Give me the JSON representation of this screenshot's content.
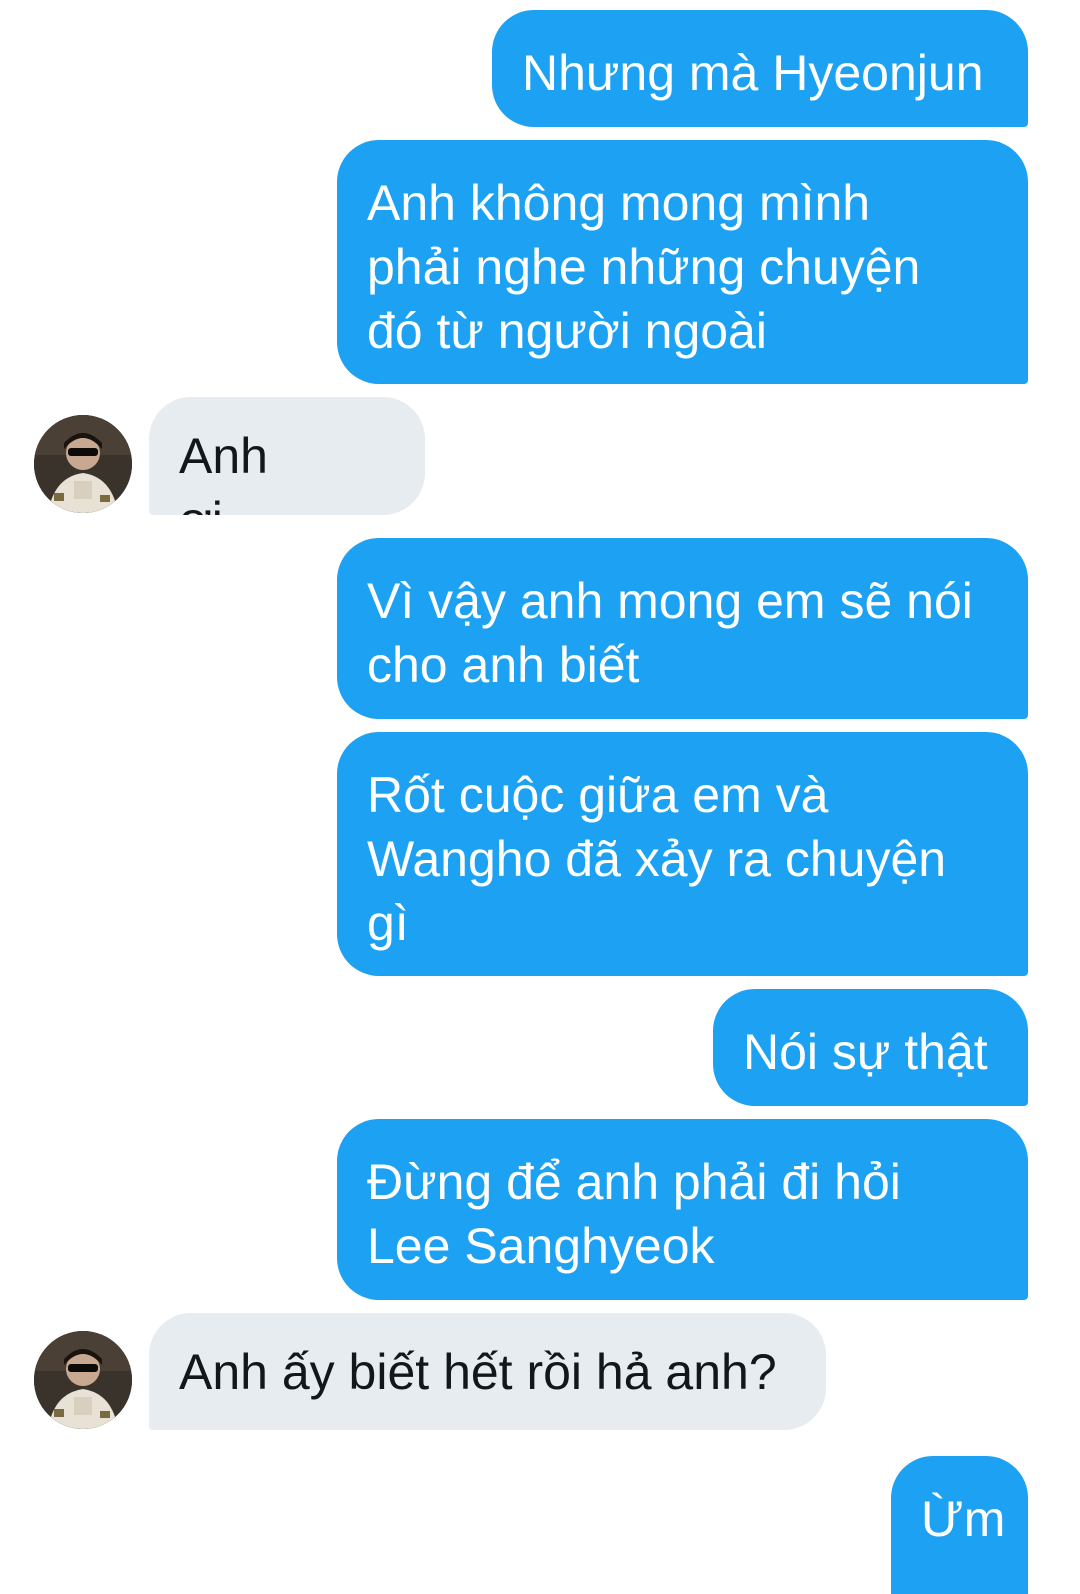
{
  "conversation": {
    "messages": [
      {
        "sender": "me",
        "text": "Nhưng mà Hyeonjun"
      },
      {
        "sender": "me",
        "text": "Anh không mong mình\nphải nghe những chuyện\nđó từ người ngoài"
      },
      {
        "sender": "other",
        "text": "Anh ơi....."
      },
      {
        "sender": "me",
        "text": "Vì vậy anh mong em sẽ nói\ncho anh biết"
      },
      {
        "sender": "me",
        "text": "Rốt cuộc giữa em và\nWangho đã xảy ra chuyện\ngì"
      },
      {
        "sender": "me",
        "text": "Nói sự thật"
      },
      {
        "sender": "me",
        "text": "Đừng để anh phải đi hỏi\nLee Sanghyeok"
      },
      {
        "sender": "other",
        "text": "Anh ấy biết hết rồi hả anh?"
      },
      {
        "sender": "me",
        "text": "Ừm"
      }
    ]
  },
  "colors": {
    "sent_bubble": "#1da1f2",
    "received_bubble": "#e6ecf0",
    "background": "#ffffff"
  }
}
